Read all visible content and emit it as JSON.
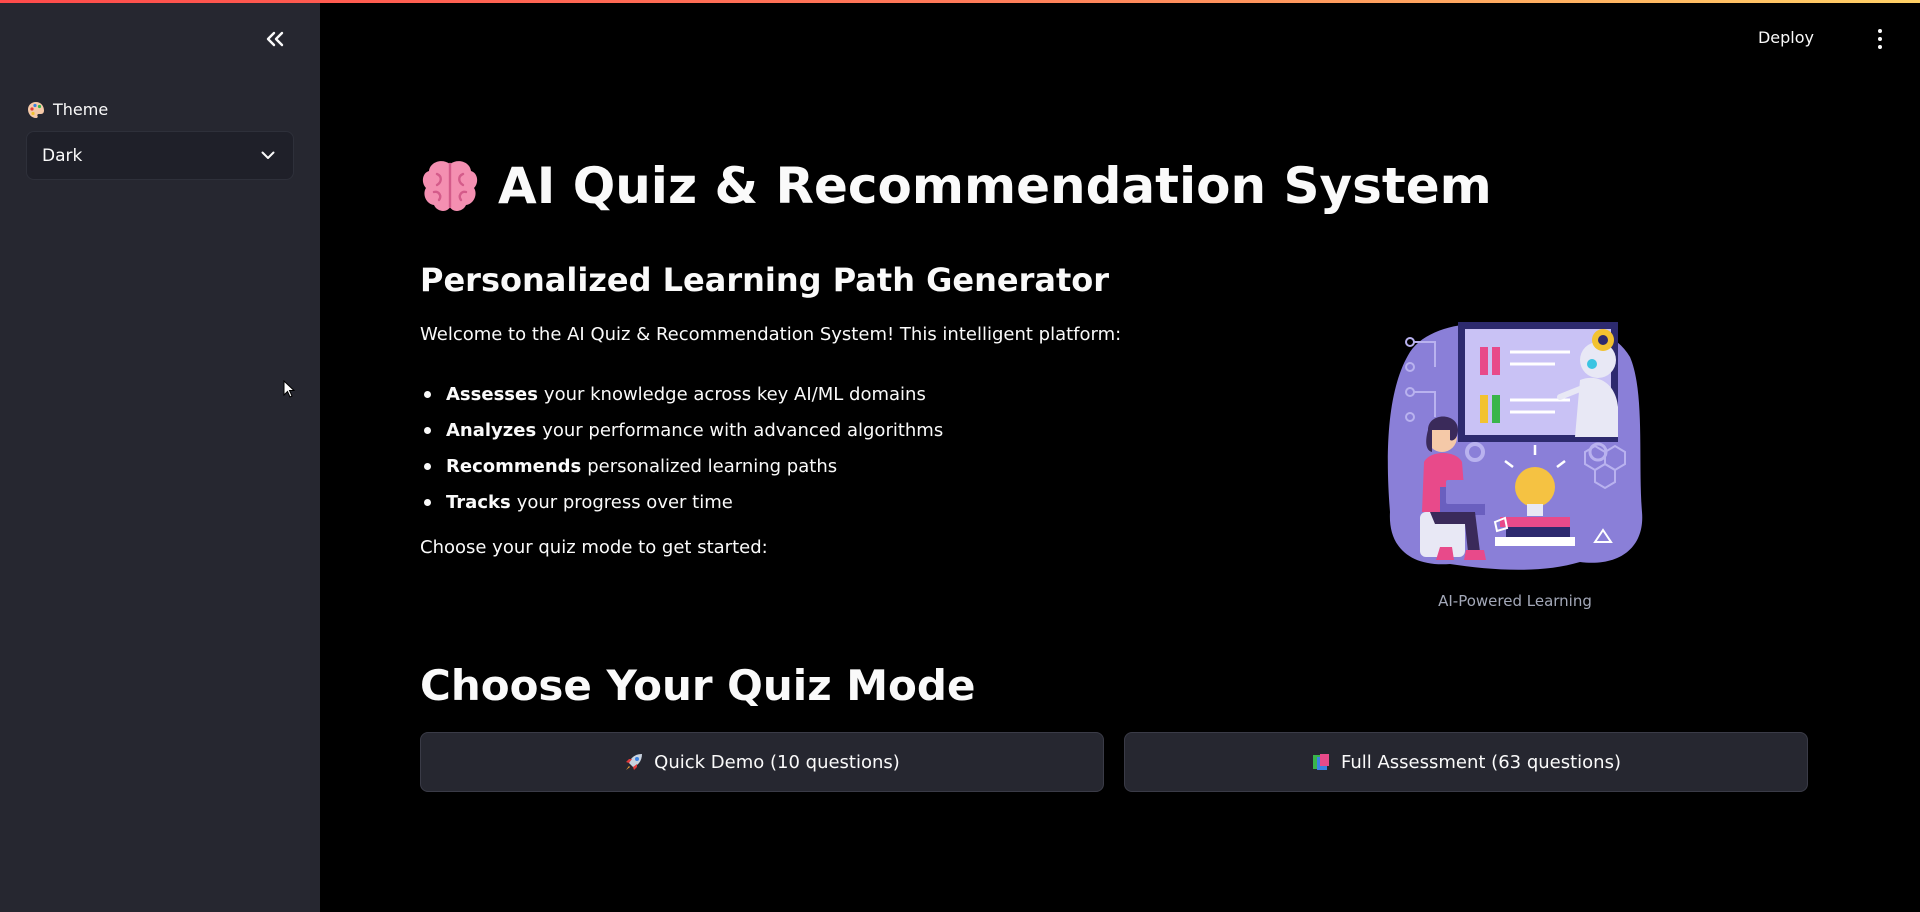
{
  "colors": {
    "accent_red": "#ff4b4b",
    "sidebar_bg": "#262730",
    "page_bg": "#000000",
    "text": "#fafafa"
  },
  "sidebar": {
    "collapse_icon": "double-chevron-left-icon",
    "theme_icon": "palette-icon",
    "theme_label": "Theme",
    "theme_select": {
      "value": "Dark"
    }
  },
  "header": {
    "deploy_label": "Deploy",
    "menu_icon": "kebab-menu-icon"
  },
  "main": {
    "title_icon": "brain-icon",
    "title": "AI Quiz & Recommendation System",
    "subtitle": "Personalized Learning Path Generator",
    "intro": "Welcome to the AI Quiz & Recommendation System! This intelligent platform:",
    "bullets": [
      {
        "bold": "Assesses",
        "text": "your knowledge across key AI/ML domains"
      },
      {
        "bold": "Analyzes",
        "text": "your performance with advanced algorithms"
      },
      {
        "bold": "Recommends",
        "text": "personalized learning paths"
      },
      {
        "bold": "Tracks",
        "text": "your progress over time"
      }
    ],
    "choose_text": "Choose your quiz mode to get started:",
    "image_caption": "AI-Powered Learning",
    "section_title": "Choose Your Quiz Mode",
    "buttons": [
      {
        "icon": "rocket-icon",
        "label": "Quick Demo (10 questions)"
      },
      {
        "icon": "books-icon",
        "label": "Full Assessment (63 questions)"
      }
    ]
  }
}
